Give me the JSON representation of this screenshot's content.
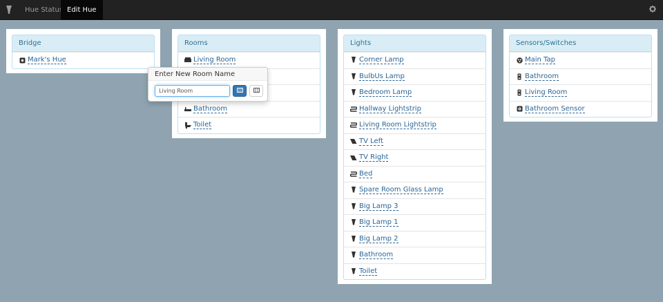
{
  "nav": {
    "tabs": [
      {
        "label": "Hue Status"
      },
      {
        "label": "Edit Hue"
      }
    ]
  },
  "bridge": {
    "heading": "Bridge",
    "items": [
      {
        "label": "Mark's Hue",
        "icon": "bridge-icon"
      }
    ]
  },
  "rooms": {
    "heading": "Rooms",
    "items": [
      {
        "label": "Living Room",
        "icon": "sofa-icon"
      },
      {
        "label": "",
        "icon": ""
      },
      {
        "label": "",
        "icon": ""
      },
      {
        "label": "Bathroom",
        "icon": "bath-icon"
      },
      {
        "label": "Toilet",
        "icon": "toilet-icon"
      }
    ]
  },
  "lights": {
    "heading": "Lights",
    "items": [
      {
        "label": "Corner Lamp",
        "icon": "bulb-icon"
      },
      {
        "label": "BulbUs Lamp",
        "icon": "bulb-icon"
      },
      {
        "label": "Bedroom Lamp",
        "icon": "bulb-icon"
      },
      {
        "label": "Hallway Lightstrip",
        "icon": "lightstrip-icon"
      },
      {
        "label": "Living Room Lightstrip",
        "icon": "lightstrip-icon"
      },
      {
        "label": "TV Left",
        "icon": "spotlight-icon"
      },
      {
        "label": "TV Right",
        "icon": "spotlight-icon"
      },
      {
        "label": "Bed",
        "icon": "lightstrip-icon"
      },
      {
        "label": "Spare Room Glass Lamp",
        "icon": "bulb-icon"
      },
      {
        "label": "Big Lamp 3",
        "icon": "bulb-icon"
      },
      {
        "label": "Big Lamp 1",
        "icon": "bulb-icon"
      },
      {
        "label": "Big Lamp 2",
        "icon": "bulb-icon"
      },
      {
        "label": "Bathroom",
        "icon": "bulb-icon"
      },
      {
        "label": "Toilet",
        "icon": "bulb-icon"
      }
    ]
  },
  "sensors": {
    "heading": "Sensors/Switches",
    "items": [
      {
        "label": "Main Tap",
        "icon": "tap-switch-icon"
      },
      {
        "label": "Bathroom",
        "icon": "dimmer-switch-icon"
      },
      {
        "label": "Living Room",
        "icon": "dimmer-switch-icon"
      },
      {
        "label": "Bathroom Sensor",
        "icon": "motion-sensor-icon"
      }
    ]
  },
  "popover": {
    "title": "Enter New Room Name",
    "input_value": "Living Room"
  },
  "colors": {
    "background": "#8fa4b0",
    "navbar": "#222222",
    "panel_heading": "#d9edf7",
    "link": "#2a6496",
    "primary_button": "#3276b1"
  }
}
